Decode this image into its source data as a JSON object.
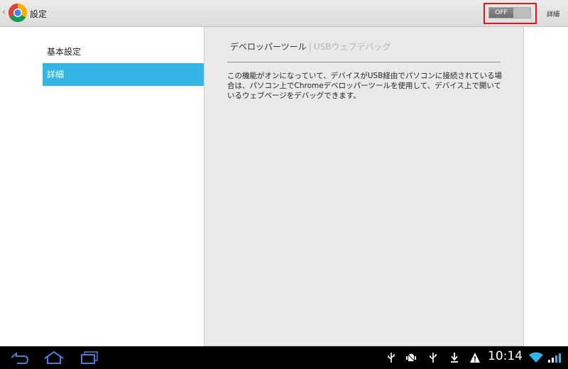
{
  "action_bar": {
    "up_caret": "‹",
    "title": "設定",
    "toggle_label": "OFF",
    "menu_detail": "詳細"
  },
  "nav": {
    "items": [
      {
        "label": "基本設定",
        "selected": false
      },
      {
        "label": "詳細",
        "selected": true
      }
    ]
  },
  "detail": {
    "title": "デベロッパーツール",
    "separator": "|",
    "subtitle": "USBウェブデバッグ",
    "description": "この機能がオンになっていて、デバイスがUSB経由でパソコンに接続されている場合は、パソコン上でChromeデベロッパーツールを使用して、デバイス上で開いているウェブページをデバッグできます。"
  },
  "system_bar": {
    "clock": "10:14",
    "icons": [
      "back-icon",
      "home-icon",
      "recent-apps-icon",
      "usb-icon",
      "android-debug-icon",
      "usb-icon",
      "download-icon",
      "warning-icon",
      "wifi-icon",
      "battery-icon"
    ]
  },
  "colors": {
    "accent": "#33b5e5",
    "highlight_box": "#e0141e",
    "panel_bg": "#e9e9e9"
  }
}
